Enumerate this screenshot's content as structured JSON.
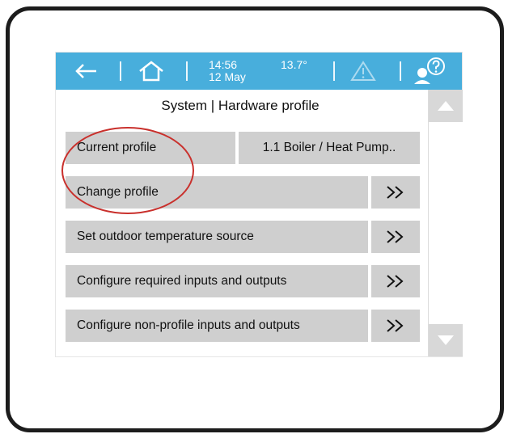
{
  "header": {
    "back_icon": "back-arrow-icon",
    "home_icon": "home-icon",
    "time": "14:56",
    "date": "12 May",
    "temperature": "13.7°",
    "warning_icon": "warning-triangle-icon",
    "help_icon": "user-help-icon"
  },
  "page": {
    "title": "System | Hardware profile"
  },
  "rows": [
    {
      "label": "Current profile",
      "value": "1.1 Boiler / Heat Pump.."
    },
    {
      "label": "Change profile",
      "chevron": "double-chevron-right-icon"
    },
    {
      "label": "Set outdoor temperature source",
      "chevron": "double-chevron-right-icon"
    },
    {
      "label": "Configure required inputs and outputs",
      "chevron": "double-chevron-right-icon"
    },
    {
      "label": "Configure non-profile inputs and outputs",
      "chevron": "double-chevron-right-icon"
    }
  ],
  "scrollbar": {
    "up_icon": "scroll-up-triangle-icon",
    "down_icon": "scroll-down-triangle-icon"
  },
  "colors": {
    "topbar": "#48aedc",
    "row_bg": "#cfcfcf",
    "highlight": "#c9302c"
  }
}
